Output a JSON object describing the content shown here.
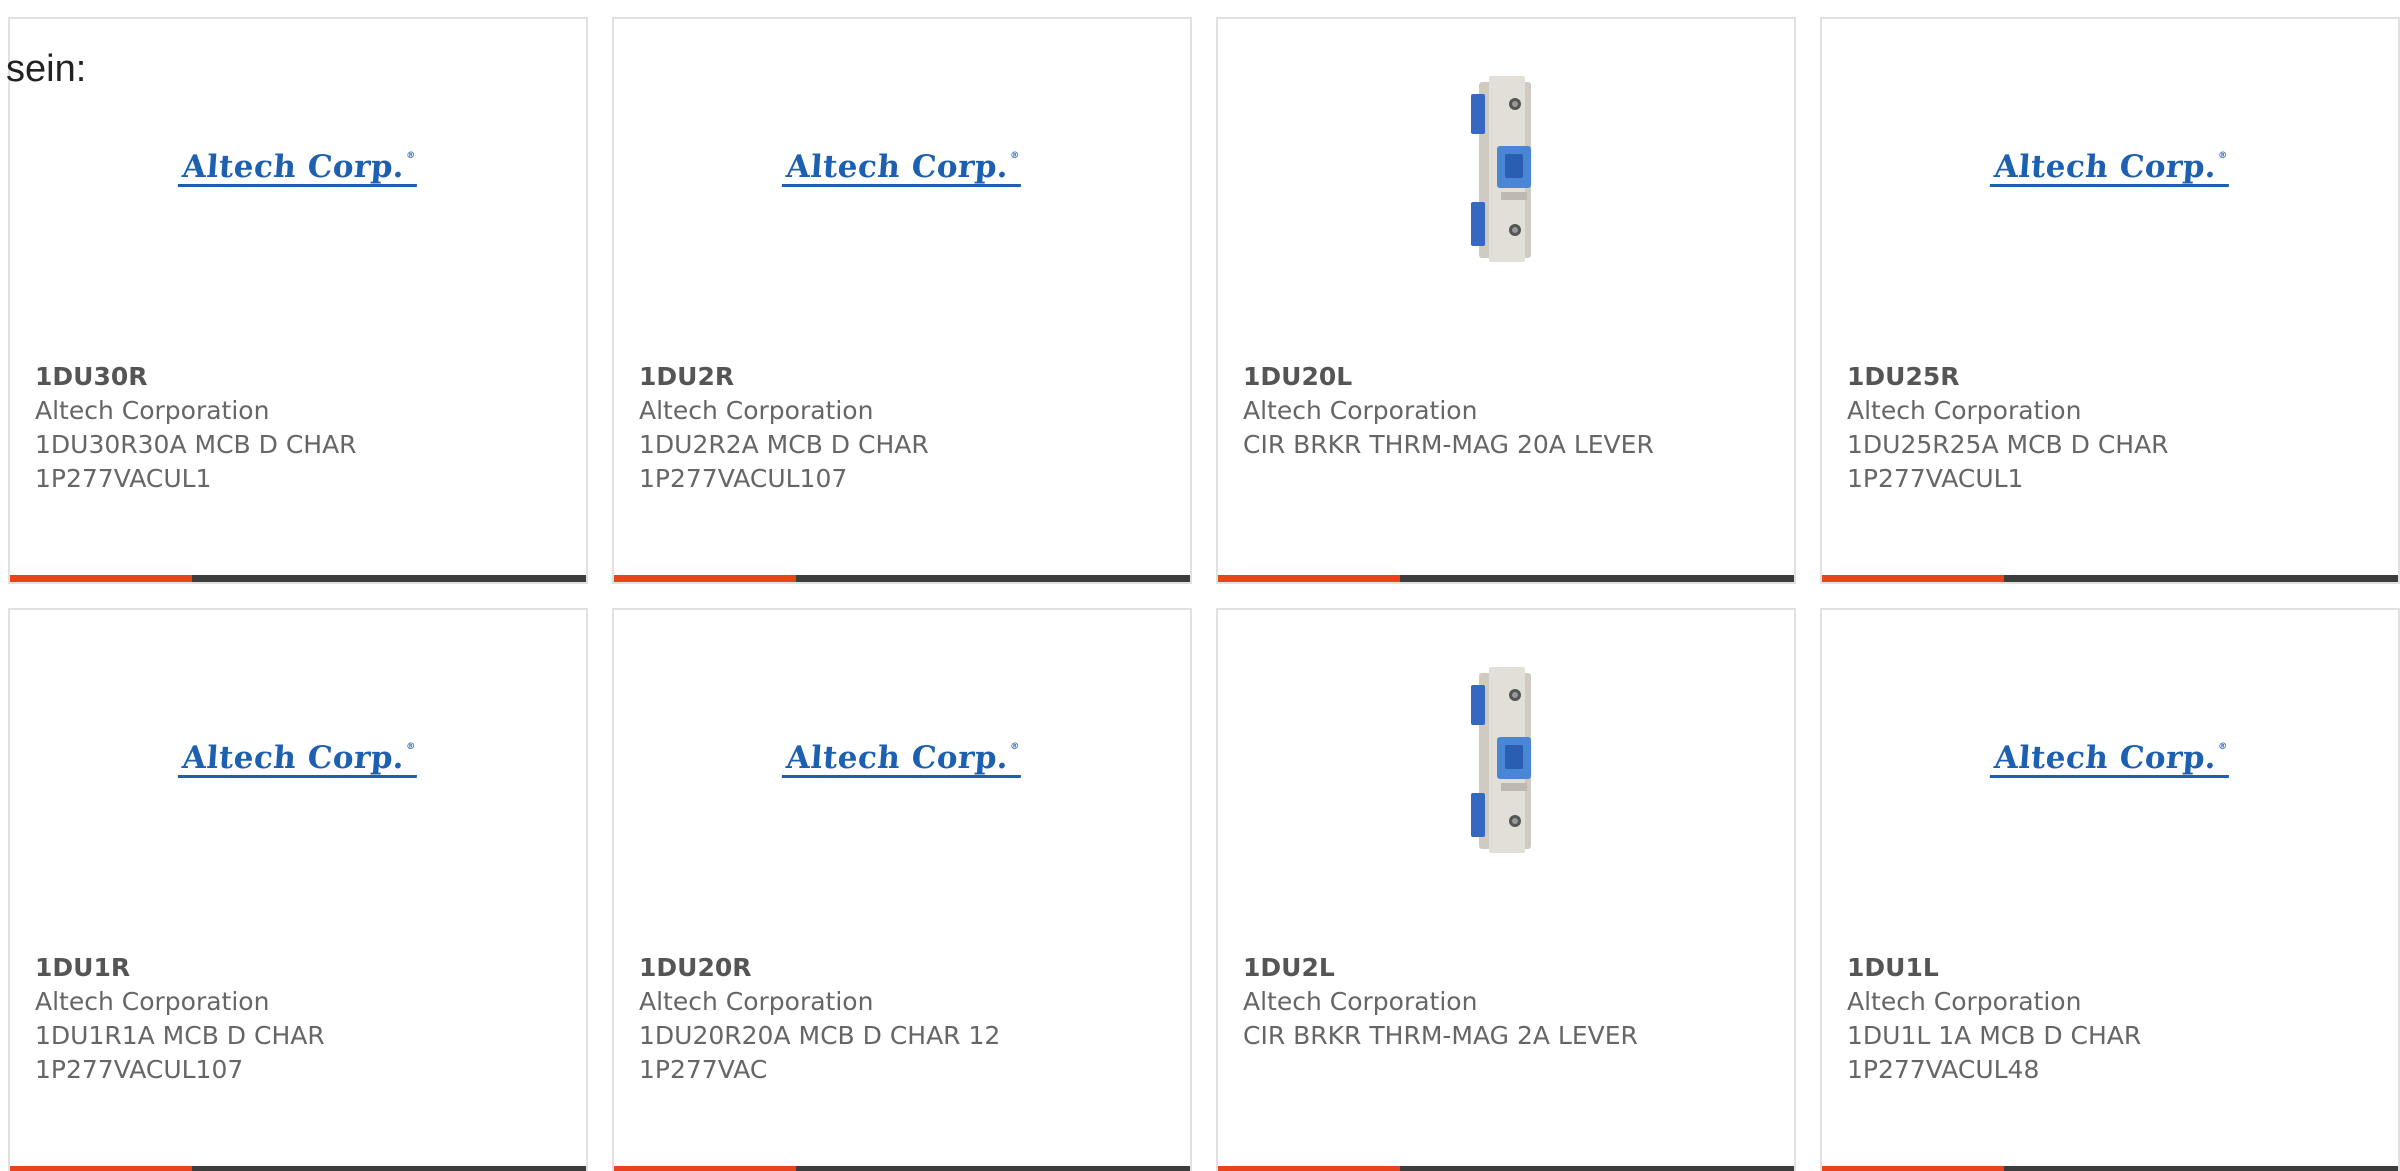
{
  "lead_text": "sein:",
  "brand_logo_text": "Altech Corp.",
  "brand_logo_mark": "®",
  "accent_color": "#e8431c",
  "bar_color": "#3d3d3d",
  "logo_color": "#1d5fb0",
  "products": [
    {
      "part": "1DU30R",
      "maker": "Altech Corporation",
      "desc_line1": "1DU30R30A MCB D CHAR",
      "desc_line2": "1P277VACUL1",
      "image": "logo"
    },
    {
      "part": "1DU2R",
      "maker": "Altech Corporation",
      "desc_line1": "1DU2R2A MCB D CHAR",
      "desc_line2": "1P277VACUL107",
      "image": "logo"
    },
    {
      "part": "1DU20L",
      "maker": "Altech Corporation",
      "desc_line1": "CIR BRKR THRM-MAG 20A LEVER",
      "desc_line2": "",
      "image": "breaker-photo"
    },
    {
      "part": "1DU25R",
      "maker": "Altech Corporation",
      "desc_line1": "1DU25R25A MCB D CHAR",
      "desc_line2": "1P277VACUL1",
      "image": "logo"
    },
    {
      "part": "1DU1R",
      "maker": "Altech Corporation",
      "desc_line1": "1DU1R1A MCB D CHAR",
      "desc_line2": "1P277VACUL107",
      "image": "logo"
    },
    {
      "part": "1DU20R",
      "maker": "Altech Corporation",
      "desc_line1": "1DU20R20A MCB D CHAR 12",
      "desc_line2": "1P277VAC",
      "image": "logo"
    },
    {
      "part": "1DU2L",
      "maker": "Altech Corporation",
      "desc_line1": "CIR BRKR THRM-MAG 2A LEVER",
      "desc_line2": "",
      "image": "breaker-photo"
    },
    {
      "part": "1DU1L",
      "maker": "Altech Corporation",
      "desc_line1": "1DU1L 1A MCB D CHAR",
      "desc_line2": "1P277VACUL48",
      "image": "logo"
    }
  ]
}
